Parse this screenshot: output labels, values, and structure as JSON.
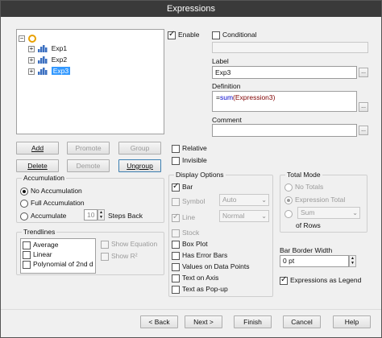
{
  "window": {
    "title": "Expressions"
  },
  "tree": {
    "items": [
      {
        "label": "Exp1"
      },
      {
        "label": "Exp2"
      },
      {
        "label": "Exp3",
        "selected": true
      }
    ]
  },
  "buttons": {
    "add": "Add",
    "promote": "Promote",
    "group": "Group",
    "delete": "Delete",
    "demote": "Demote",
    "ungroup": "Ungroup"
  },
  "accumulation": {
    "title": "Accumulation",
    "no_accumulation": "No Accumulation",
    "full_accumulation": "Full Accumulation",
    "accumulate": "Accumulate",
    "steps_value": "10",
    "steps_label": "Steps Back"
  },
  "trendlines": {
    "title": "Trendlines",
    "items": [
      "Average",
      "Linear",
      "Polynomial of 2nd d"
    ],
    "show_equation": "Show Equation",
    "show_r2": "Show R²"
  },
  "general": {
    "enable": "Enable",
    "conditional": "Conditional",
    "label_caption": "Label",
    "label_value": "Exp3",
    "definition_caption": "Definition",
    "definition_prefix": "=",
    "definition_func": "sum",
    "definition_args": "(Expression3)",
    "comment_caption": "Comment",
    "relative": "Relative",
    "invisible": "Invisible"
  },
  "display_options": {
    "title": "Display Options",
    "bar": "Bar",
    "symbol": "Symbol",
    "symbol_select": "Auto",
    "line": "Line",
    "line_select": "Normal",
    "stock": "Stock",
    "box_plot": "Box Plot",
    "has_error_bars": "Has Error Bars",
    "values_on_data_points": "Values on Data Points",
    "text_on_axis": "Text on Axis",
    "text_as_popup": "Text as Pop-up"
  },
  "total_mode": {
    "title": "Total Mode",
    "no_totals": "No Totals",
    "expression_total": "Expression Total",
    "sum_select": "Sum",
    "of_rows": "of Rows"
  },
  "bar_border": {
    "caption": "Bar Border Width",
    "value": "0 pt",
    "expressions_as_legend": "Expressions as Legend"
  },
  "footer": {
    "back": "< Back",
    "next": "Next >",
    "finish": "Finish",
    "cancel": "Cancel",
    "help": "Help"
  },
  "colors": {
    "selection": "#3399ff",
    "func_color": "#0000cc",
    "args_color": "#800000"
  }
}
